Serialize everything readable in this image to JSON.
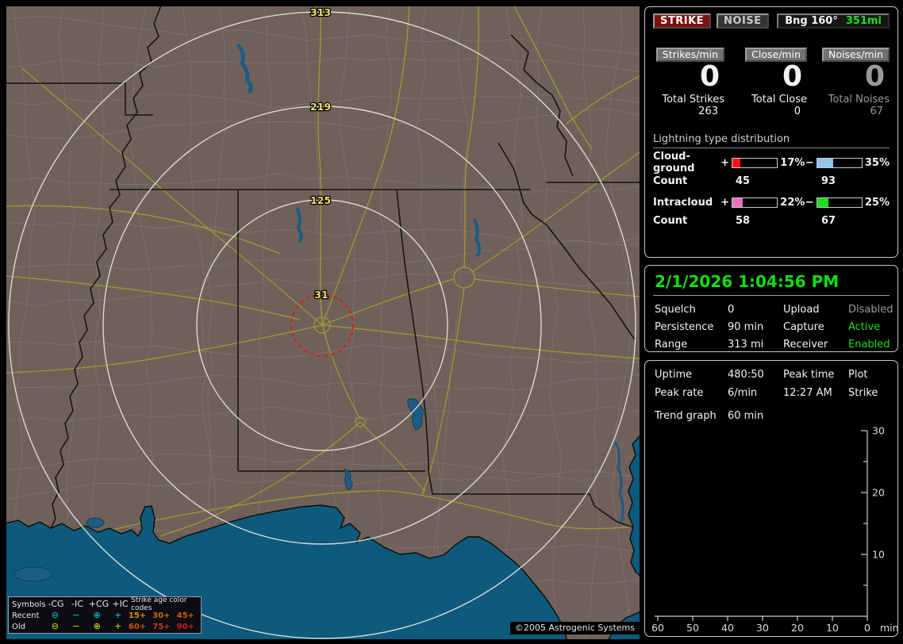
{
  "map": {
    "range_labels": [
      "313",
      "219",
      "125",
      "31"
    ],
    "legend": {
      "title_symbols": "Symbols",
      "columns": [
        "-CG",
        "-IC",
        "+CG",
        "+IC"
      ],
      "age_title": "Strike age color codes",
      "rows": [
        {
          "label": "Recent",
          "symbol_color": "#00dde8",
          "glyphs": [
            "⊖",
            "−",
            "⊕",
            "+"
          ],
          "ages": [
            "15+",
            "30+",
            "45+"
          ],
          "age_colors": [
            "#d68e00",
            "#cf6c00",
            "#cf5a00"
          ]
        },
        {
          "label": "Old",
          "symbol_color": "#e6e600",
          "glyphs": [
            "⊖",
            "−",
            "⊕",
            "+"
          ],
          "ages": [
            "60+",
            "75+",
            "90+"
          ],
          "age_colors": [
            "#cf5200",
            "#cf3812",
            "#cf1c12"
          ]
        }
      ]
    },
    "copyright": "©2005 Astrogenic Systems"
  },
  "sidebar": {
    "strike_button": "STRIKE",
    "noise_button": "NOISE",
    "bearing_label": "Bng 160°",
    "bearing_value": "351mi",
    "bearing_value_color": "#1ee01e",
    "counters": [
      {
        "label": "Strikes/min",
        "value": "0",
        "total_label": "Total Strikes",
        "total": "263"
      },
      {
        "label": "Close/min",
        "value": "0",
        "total_label": "Total Close",
        "total": "0"
      },
      {
        "label": "Noises/min",
        "value": "0",
        "total_label": "Total Noises",
        "total": "67"
      }
    ],
    "distribution": {
      "title": "Lightning type distribution",
      "count_label": "Count",
      "plus_sign": "+",
      "minus_sign": "−",
      "rows": [
        {
          "label": "Cloud-ground",
          "pos_pct": "17%",
          "pos_val": 17,
          "pos_color": "#ff1414",
          "pos_count": "45",
          "neg_pct": "35%",
          "neg_val": 35,
          "neg_color": "#8fc3ea",
          "neg_count": "93"
        },
        {
          "label": "Intracloud",
          "pos_pct": "22%",
          "pos_val": 22,
          "pos_color": "#e473bd",
          "pos_count": "58",
          "neg_pct": "25%",
          "neg_val": 25,
          "neg_color": "#1ddd1d",
          "neg_count": "67"
        }
      ]
    },
    "status": {
      "datetime": "2/1/2026 1:04:56 PM",
      "rows": [
        {
          "k1": "Squelch",
          "v1": "0",
          "k2": "Upload",
          "v2": "Disabled",
          "v2_state": "dim"
        },
        {
          "k1": "Persistence",
          "v1": "90 min",
          "k2": "Capture",
          "v2": "Active",
          "v2_state": "green"
        },
        {
          "k1": "Range",
          "v1": "313 mi",
          "k2": "Receiver",
          "v2": "Enabled",
          "v2_state": "green"
        }
      ]
    },
    "stats": {
      "uptime_label": "Uptime",
      "uptime": "480:50",
      "peak_time_label": "Peak time",
      "plot_label": "Plot",
      "peak_rate_label": "Peak rate",
      "peak_rate": "6/min",
      "peak_time": "12:27 AM",
      "plot_value": "Strike",
      "trend_label": "Trend graph",
      "trend_value": "60 min"
    }
  },
  "chart_data": {
    "type": "line",
    "title": "Trend graph",
    "window": "60 min",
    "xlabel": "min",
    "x_ticks": [
      60,
      50,
      40,
      30,
      20,
      10,
      0
    ],
    "y_ticks": [
      30,
      20,
      10
    ],
    "y_minor_ticks": [
      25,
      15,
      5
    ],
    "ylim": [
      0,
      30
    ],
    "xlim_minutes_ago": [
      60,
      0
    ],
    "series": [
      {
        "name": "Strike",
        "x": [],
        "values": []
      }
    ]
  }
}
